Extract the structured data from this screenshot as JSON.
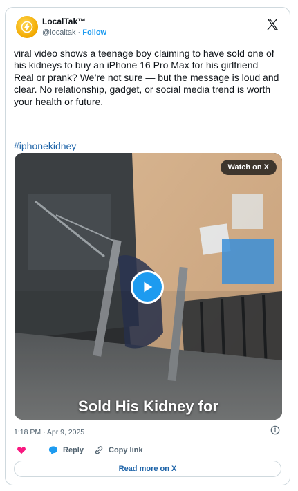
{
  "account": {
    "name": "LocalTak™",
    "handle": "@localtak",
    "separator": "·",
    "follow_label": "Follow"
  },
  "post": {
    "text": "viral video shows a teenage boy claiming to have sold one of his kidneys to buy an iPhone 16 Pro Max for his girlfriend\nReal or prank? We’re not sure — but the message is loud and clear. No relationship, gadget, or social media trend is worth your health or future.",
    "hashtag": "#iphonekidney",
    "timestamp": "1:18 PM · Apr 9, 2025"
  },
  "media": {
    "watch_label": "Watch on X",
    "caption": "Sold His Kidney for"
  },
  "actions": {
    "reply_label": "Reply",
    "copy_label": "Copy link"
  },
  "footer": {
    "read_more_label": "Read more on X"
  },
  "colors": {
    "accent": "#1d9bf0",
    "link": "#1d63a8",
    "like": "#f91880",
    "muted": "#536471"
  },
  "icons": [
    "lightning-avatar-icon",
    "x-logo-icon",
    "play-icon",
    "info-icon",
    "heart-icon",
    "reply-bubble-icon",
    "link-icon"
  ]
}
